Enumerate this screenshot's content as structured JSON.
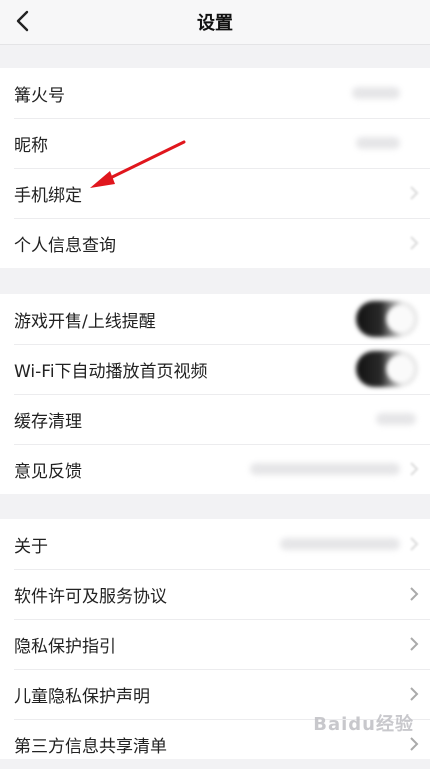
{
  "header": {
    "title": "设置",
    "back_icon": "chevron-left-icon"
  },
  "group1": [
    {
      "label": "篝火号"
    },
    {
      "label": "昵称"
    },
    {
      "label": "手机绑定"
    },
    {
      "label": "个人信息查询"
    }
  ],
  "group2": [
    {
      "label": "游戏开售/上线提醒"
    },
    {
      "label": "Wi-Fi下自动播放首页视频"
    },
    {
      "label": "缓存清理"
    },
    {
      "label": "意见反馈"
    }
  ],
  "group3": [
    {
      "label": "关于"
    },
    {
      "label": "软件许可及服务协议"
    },
    {
      "label": "隐私保护指引"
    },
    {
      "label": "儿童隐私保护声明"
    },
    {
      "label": "第三方信息共享清单"
    }
  ],
  "watermark": "Baidu经验",
  "colors": {
    "arrow": "#e0161d",
    "background": "#f2f2f4",
    "row": "#ffffff"
  }
}
